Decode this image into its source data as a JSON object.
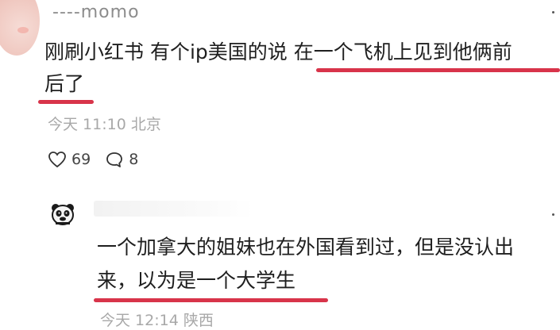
{
  "post": {
    "username": "----momo",
    "line1": "刚刷小红书 有个ip美国的说 在一个飞机上见到他俩前",
    "line2": "后了",
    "time": "今天 11:10 北京",
    "likes": "69",
    "replies": "8"
  },
  "reply": {
    "line1": "一个加拿大的姐妹也在外国看到过，但是没认出",
    "line2": "来，以为是一个大学生",
    "time": "今天 12:14 陕西"
  },
  "colors": {
    "underline": "#d8344a",
    "meta": "#a8a8a8"
  }
}
